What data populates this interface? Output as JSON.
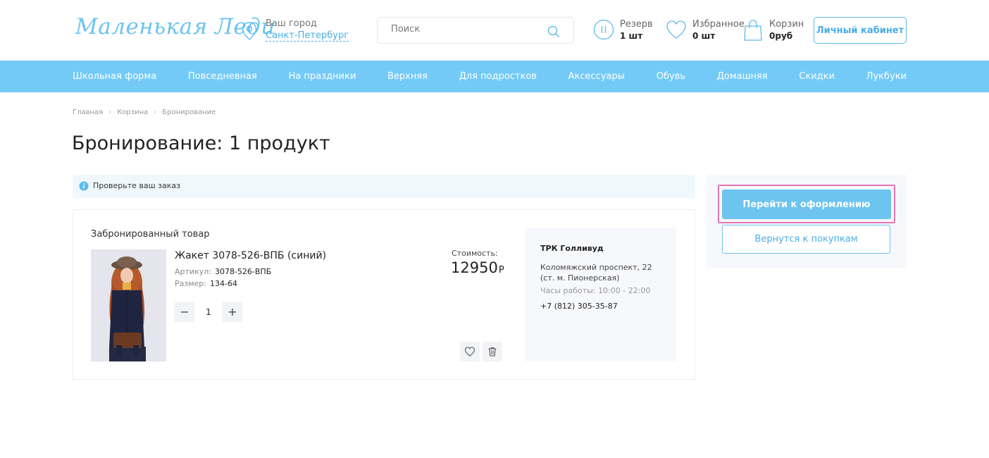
{
  "header": {
    "logo_text": "Маленькая Леди",
    "city_label": "Ваш город",
    "city_value": "Санкт-Петербург",
    "search_placeholder": "Поиск",
    "reserve_label": "Резерв",
    "reserve_value": "1 шт",
    "favorites_label": "Избранное",
    "favorites_value": "0 шт",
    "cart_label": "Корзин",
    "cart_value": "0руб",
    "account_button": "Личный кабинет"
  },
  "nav": {
    "items": [
      "Школьная форма",
      "Повседневная",
      "На праздники",
      "Верхняя",
      "Для подростков",
      "Аксессуары",
      "Обувь",
      "Домашняя",
      "Скидки",
      "Лукбуки"
    ]
  },
  "breadcrumb": [
    "Главная",
    "Корзина",
    "Бронирование"
  ],
  "page_title": "Бронирование: 1 продукт",
  "notice": "Проверьте ваш заказ",
  "order": {
    "section_title": "Забронированный товар",
    "product_name": "Жакет 3078-526-ВПБ (синий)",
    "sku_label": "Артикул:",
    "sku_value": "3078-526-ВПБ",
    "size_label": "Размер:",
    "size_value": "134-64",
    "quantity": "1",
    "minus": "−",
    "plus": "+",
    "cost_label": "Стоимость:",
    "cost_value": "12950",
    "currency": "Р"
  },
  "store": {
    "name": "ТРК Голливуд",
    "address": "Коломяжский проспект, 22 (ст. м. Пионерская)",
    "hours": "Часы работы: 10:00 - 22:00",
    "phone": "+7 (812) 305-35-87"
  },
  "side": {
    "checkout_button": "Перейти к оформлению",
    "back_button": "Вернутся к покупкам"
  },
  "colors": {
    "accent": "#74caf7",
    "accent_text": "#4aaee6",
    "highlight_border": "#e277b4"
  },
  "icons": [
    "location-pin-icon",
    "search-icon",
    "pause-icon",
    "heart-icon",
    "shopping-bag-icon",
    "info-icon",
    "trash-icon"
  ]
}
